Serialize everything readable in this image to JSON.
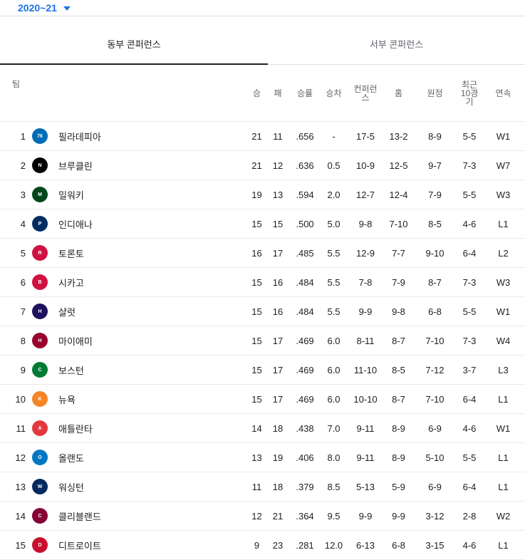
{
  "season": {
    "label": "2020~21"
  },
  "tabs": [
    {
      "label": "동부 콘퍼런스",
      "active": true
    },
    {
      "label": "서부 콘퍼런스",
      "active": false
    }
  ],
  "headers": {
    "team": "팀",
    "w": "승",
    "l": "패",
    "pct": "승률",
    "gb": "승차",
    "conf": "컨퍼런스",
    "home": "홈",
    "away": "원정",
    "l10": "최근10경기",
    "strk": "연속"
  },
  "teams": [
    {
      "rank": "1",
      "name": "필라데피아",
      "logo": "sixers-logo",
      "logo_color": "#006bb6",
      "logo_text": "76",
      "w": "21",
      "l": "11",
      "pct": ".656",
      "gb": "-",
      "conf": "17-5",
      "home": "13-2",
      "away": "8-9",
      "l10": "5-5",
      "strk": "W1"
    },
    {
      "rank": "2",
      "name": "브루클린",
      "logo": "nets-logo",
      "logo_color": "#000000",
      "logo_text": "N",
      "w": "21",
      "l": "12",
      "pct": ".636",
      "gb": "0.5",
      "conf": "10-9",
      "home": "12-5",
      "away": "9-7",
      "l10": "7-3",
      "strk": "W7"
    },
    {
      "rank": "3",
      "name": "밀워키",
      "logo": "bucks-logo",
      "logo_color": "#00471b",
      "logo_text": "M",
      "w": "19",
      "l": "13",
      "pct": ".594",
      "gb": "2.0",
      "conf": "12-7",
      "home": "12-4",
      "away": "7-9",
      "l10": "5-5",
      "strk": "W3"
    },
    {
      "rank": "4",
      "name": "인디애나",
      "logo": "pacers-logo",
      "logo_color": "#002d62",
      "logo_text": "P",
      "w": "15",
      "l": "15",
      "pct": ".500",
      "gb": "5.0",
      "conf": "9-8",
      "home": "7-10",
      "away": "8-5",
      "l10": "4-6",
      "strk": "L1"
    },
    {
      "rank": "5",
      "name": "토론토",
      "logo": "raptors-logo",
      "logo_color": "#ce1141",
      "logo_text": "R",
      "w": "16",
      "l": "17",
      "pct": ".485",
      "gb": "5.5",
      "conf": "12-9",
      "home": "7-7",
      "away": "9-10",
      "l10": "6-4",
      "strk": "L2"
    },
    {
      "rank": "6",
      "name": "시카고",
      "logo": "bulls-logo",
      "logo_color": "#ce1141",
      "logo_text": "B",
      "w": "15",
      "l": "16",
      "pct": ".484",
      "gb": "5.5",
      "conf": "7-8",
      "home": "7-9",
      "away": "8-7",
      "l10": "7-3",
      "strk": "W3"
    },
    {
      "rank": "7",
      "name": "샬럿",
      "logo": "hornets-logo",
      "logo_color": "#1d1160",
      "logo_text": "H",
      "w": "15",
      "l": "16",
      "pct": ".484",
      "gb": "5.5",
      "conf": "9-9",
      "home": "9-8",
      "away": "6-8",
      "l10": "5-5",
      "strk": "W1"
    },
    {
      "rank": "8",
      "name": "마이애미",
      "logo": "heat-logo",
      "logo_color": "#98002e",
      "logo_text": "H",
      "w": "15",
      "l": "17",
      "pct": ".469",
      "gb": "6.0",
      "conf": "8-11",
      "home": "8-7",
      "away": "7-10",
      "l10": "7-3",
      "strk": "W4"
    },
    {
      "rank": "9",
      "name": "보스턴",
      "logo": "celtics-logo",
      "logo_color": "#007a33",
      "logo_text": "C",
      "w": "15",
      "l": "17",
      "pct": ".469",
      "gb": "6.0",
      "conf": "11-10",
      "home": "8-5",
      "away": "7-12",
      "l10": "3-7",
      "strk": "L3"
    },
    {
      "rank": "10",
      "name": "뉴욕",
      "logo": "knicks-logo",
      "logo_color": "#f58426",
      "logo_text": "K",
      "w": "15",
      "l": "17",
      "pct": ".469",
      "gb": "6.0",
      "conf": "10-10",
      "home": "8-7",
      "away": "7-10",
      "l10": "6-4",
      "strk": "L1"
    },
    {
      "rank": "11",
      "name": "애틀란타",
      "logo": "hawks-logo",
      "logo_color": "#e03a3e",
      "logo_text": "A",
      "w": "14",
      "l": "18",
      "pct": ".438",
      "gb": "7.0",
      "conf": "9-11",
      "home": "8-9",
      "away": "6-9",
      "l10": "4-6",
      "strk": "W1"
    },
    {
      "rank": "12",
      "name": "올랜도",
      "logo": "magic-logo",
      "logo_color": "#0077c0",
      "logo_text": "O",
      "w": "13",
      "l": "19",
      "pct": ".406",
      "gb": "8.0",
      "conf": "9-11",
      "home": "8-9",
      "away": "5-10",
      "l10": "5-5",
      "strk": "L1"
    },
    {
      "rank": "13",
      "name": "워싱턴",
      "logo": "wizards-logo",
      "logo_color": "#002b5c",
      "logo_text": "W",
      "w": "11",
      "l": "18",
      "pct": ".379",
      "gb": "8.5",
      "conf": "5-13",
      "home": "5-9",
      "away": "6-9",
      "l10": "6-4",
      "strk": "L1"
    },
    {
      "rank": "14",
      "name": "클리블랜드",
      "logo": "cavaliers-logo",
      "logo_color": "#860038",
      "logo_text": "C",
      "w": "12",
      "l": "21",
      "pct": ".364",
      "gb": "9.5",
      "conf": "9-9",
      "home": "9-9",
      "away": "3-12",
      "l10": "2-8",
      "strk": "W2"
    },
    {
      "rank": "15",
      "name": "디트로이트",
      "logo": "pistons-logo",
      "logo_color": "#c8102e",
      "logo_text": "D",
      "w": "9",
      "l": "23",
      "pct": ".281",
      "gb": "12.0",
      "conf": "6-13",
      "home": "6-8",
      "away": "3-15",
      "l10": "4-6",
      "strk": "L1"
    }
  ]
}
